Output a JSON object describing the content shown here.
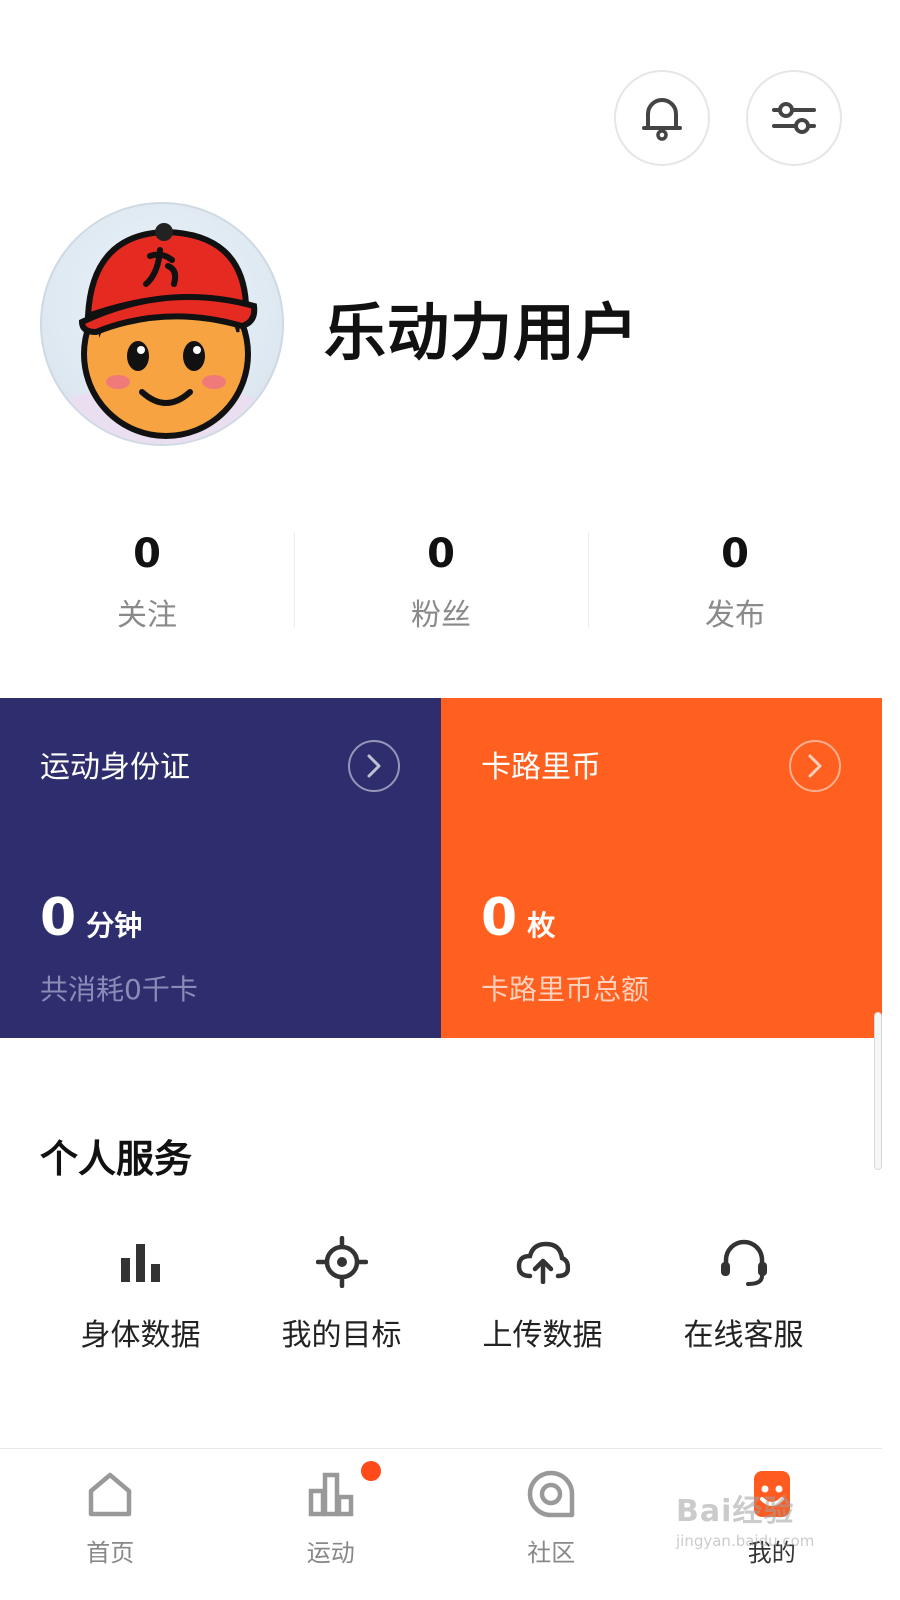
{
  "header": {
    "notifications_icon": "bell-icon",
    "settings_icon": "sliders-icon"
  },
  "profile": {
    "username": "乐动力用户",
    "avatar_icon": "cartoon-avatar-red-cap"
  },
  "stats": [
    {
      "value": "0",
      "label": "关注"
    },
    {
      "value": "0",
      "label": "粉丝"
    },
    {
      "value": "0",
      "label": "发布"
    }
  ],
  "cards": {
    "sport_id": {
      "title": "运动身份证",
      "value": "0",
      "unit": "分钟",
      "subtitle": "共消耗0千卡",
      "color": "#2e2d6e"
    },
    "calorie_coin": {
      "title": "卡路里币",
      "value": "0",
      "unit": "枚",
      "subtitle": "卡路里币总额",
      "color": "#ff6020"
    }
  },
  "services": {
    "title": "个人服务",
    "items": [
      {
        "label": "身体数据",
        "icon": "bar-chart-icon"
      },
      {
        "label": "我的目标",
        "icon": "target-icon"
      },
      {
        "label": "上传数据",
        "icon": "cloud-upload-icon"
      },
      {
        "label": "在线客服",
        "icon": "headset-icon"
      }
    ]
  },
  "bottom_nav": {
    "items": [
      {
        "label": "首页",
        "icon": "home-icon"
      },
      {
        "label": "运动",
        "icon": "sport-chart-icon",
        "badge": true
      },
      {
        "label": "社区",
        "icon": "community-icon"
      },
      {
        "label": "我的",
        "icon": "profile-icon",
        "active": true
      }
    ],
    "active_color": "#ff5a1f"
  },
  "watermark": {
    "main": "Bai经验",
    "sub": "jingyan.baidu.com"
  }
}
